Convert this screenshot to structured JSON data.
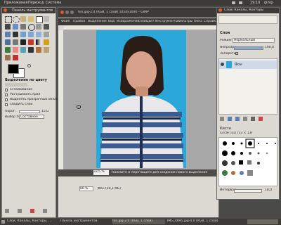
{
  "topbar": {
    "menus": [
      "Приложения",
      "Переход",
      "Система"
    ],
    "clock": "19:10",
    "user_label": "gimp"
  },
  "toolbox": {
    "title": "Панель инструментов",
    "section_title": "Выделение по цвету",
    "options": [
      "Сглаживание",
      "Растушевать края",
      "Выделять прозрачные области",
      "Сводить слои"
    ],
    "threshold_label": "Порог:",
    "threshold_value": "15,0",
    "select_by_label": "Выбор по:",
    "select_by_value": "Составное"
  },
  "image_window": {
    "title": "fon.jpg-2.0 (RGB, 1 слой) 1054x1000 – GIMP",
    "menus": [
      "Файл",
      "Правка",
      "Выделение",
      "Вид",
      "Изображение",
      "Слой",
      "Цвет",
      "Инструменты",
      "Фильтры",
      "Окна",
      "Справка"
    ],
    "zoom_value": "33,5 %",
    "hint_text": "Нажмите и перетащите для создания нового выделения",
    "zoom_label": "66 %",
    "layer_info": "Фон (20,1 МБ)"
  },
  "layers_panel": {
    "title": "Слои, Каналы, Контуры",
    "tab_label": "Слои",
    "mode_label": "Режим:",
    "mode_value": "Нормальный",
    "opacity_label": "Непрозр.:",
    "opacity_value": "100,0",
    "lock_label": "Запереть:",
    "layer_name": "Фон",
    "brushes_title": "Кисти",
    "brush_name": "Circle (11) (13 × 13)",
    "spacing_label": "Интервал",
    "spacing_value": "10,0"
  },
  "taskbar": {
    "items": [
      "Слои, Каналы, Контуры, ...",
      "Панель инструментов",
      "fon.jpg-2.0 (RGB, 1 слой)",
      "IMG_4895.jpg-4.0 (RGB, 1 слой)"
    ]
  },
  "colors": {
    "canvas_bg": "#a8a8a8",
    "photo_bg": "#2ba7d9",
    "select_bg": "#e9e6df",
    "panel_bg": "#dcd9d2"
  }
}
